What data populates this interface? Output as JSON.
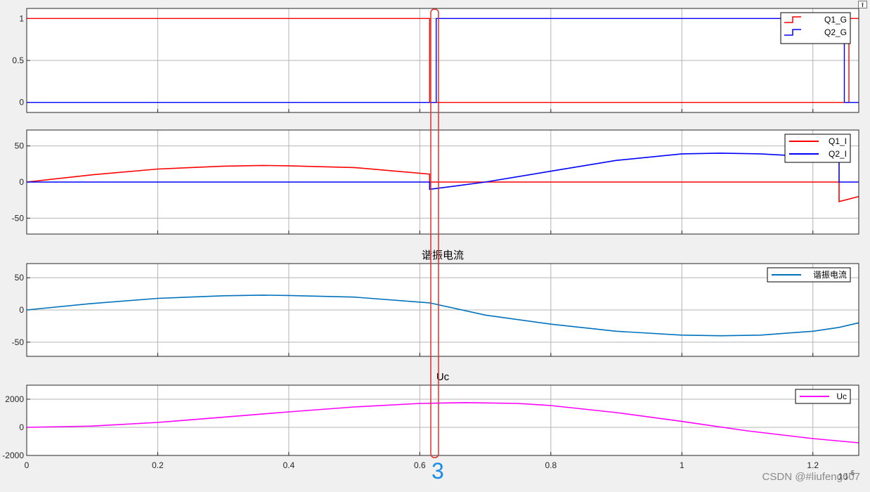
{
  "window": {
    "expand_icon": "expand-arrow-icon"
  },
  "overlay": {
    "number": "3",
    "marker_color": "#e0302a"
  },
  "watermark": "CSDN @#liufeng607",
  "colors": {
    "red": "#ff0000",
    "blue": "#0000ff",
    "teal": "#0072bd",
    "magenta": "#ff00ff",
    "grid": "#b4b4b4",
    "axis": "#262626"
  },
  "chart_data": [
    {
      "type": "line",
      "title": "",
      "xlim": [
        0,
        1.27e-05
      ],
      "ylim": [
        -0.12,
        1.12
      ],
      "yticks": [
        "1",
        "0.5",
        "0"
      ],
      "ytick_values": [
        1,
        0.5,
        0
      ],
      "legend_position": "top-right",
      "legend_style": "step",
      "series": [
        {
          "name": "Q1_G",
          "color": "#ff0000",
          "x": [
            0,
            6.15e-06,
            6.15e-06,
            1.255e-05,
            1.255e-05,
            1.27e-05
          ],
          "y": [
            1,
            1,
            0,
            0,
            1,
            1
          ]
        },
        {
          "name": "Q2_G",
          "color": "#0000ff",
          "x": [
            0,
            6.25e-06,
            6.25e-06,
            1.248e-05,
            1.248e-05,
            1.27e-05
          ],
          "y": [
            0,
            0,
            1,
            1,
            0,
            0
          ]
        }
      ]
    },
    {
      "type": "line",
      "title": "",
      "xlim": [
        0,
        1.27e-05
      ],
      "ylim": [
        -72,
        72
      ],
      "yticks": [
        "50",
        "0",
        "-50"
      ],
      "ytick_values": [
        50,
        0,
        -50
      ],
      "legend_position": "top-right",
      "legend_style": "line",
      "series": [
        {
          "name": "Q1_I",
          "color": "#ff0000",
          "x": [
            0,
            1e-06,
            2e-06,
            3e-06,
            3.6e-06,
            4e-06,
            5e-06,
            6.15e-06,
            6.15e-06,
            1.24e-05,
            1.24e-05,
            1.27e-05
          ],
          "y": [
            0,
            10,
            18,
            22,
            23,
            22.5,
            20,
            11,
            0,
            0,
            -27,
            -20
          ]
        },
        {
          "name": "Q2_I",
          "color": "#0000ff",
          "x": [
            0,
            6.15e-06,
            6.15e-06,
            6.5e-06,
            7e-06,
            8e-06,
            9e-06,
            1e-05,
            1.06e-05,
            1.12e-05,
            1.2e-05,
            1.24e-05,
            1.24e-05,
            1.27e-05
          ],
          "y": [
            0,
            0,
            -10,
            -6,
            0,
            15,
            30,
            39,
            40,
            39,
            35,
            30,
            0,
            0
          ]
        }
      ]
    },
    {
      "type": "line",
      "title": "谐振电流",
      "xlim": [
        0,
        1.27e-05
      ],
      "ylim": [
        -72,
        72
      ],
      "yticks": [
        "50",
        "0",
        "-50"
      ],
      "ytick_values": [
        50,
        0,
        -50
      ],
      "legend_position": "top-right",
      "legend_style": "line",
      "series": [
        {
          "name": "谐振电流",
          "color": "#0072bd",
          "x": [
            0,
            1e-06,
            2e-06,
            3e-06,
            3.6e-06,
            4e-06,
            5e-06,
            6.15e-06,
            7e-06,
            8e-06,
            9e-06,
            1e-05,
            1.06e-05,
            1.12e-05,
            1.2e-05,
            1.24e-05,
            1.27e-05
          ],
          "y": [
            0,
            10,
            18,
            22,
            23,
            22.5,
            20,
            11,
            -8,
            -22,
            -33,
            -39,
            -40,
            -39,
            -33,
            -27,
            -20
          ]
        }
      ]
    },
    {
      "type": "line",
      "title": "Uc",
      "xlim": [
        0,
        1.27e-05
      ],
      "ylim": [
        -2000,
        3000
      ],
      "yticks": [
        "2000",
        "0",
        "-2000"
      ],
      "ytick_values": [
        2000,
        0,
        -2000
      ],
      "xticks": [
        "0",
        "0.2",
        "0.4",
        "0.6",
        "0.8",
        "1",
        "1.2"
      ],
      "xtick_values": [
        0,
        2e-06,
        4e-06,
        6e-06,
        8e-06,
        1e-05,
        1.2e-05
      ],
      "x_exponent": "10",
      "x_exponent_power": "-5",
      "legend_position": "top-right",
      "legend_style": "line",
      "series": [
        {
          "name": "Uc",
          "color": "#ff00ff",
          "x": [
            0,
            1e-06,
            2e-06,
            3e-06,
            4e-06,
            5e-06,
            6e-06,
            6.7e-06,
            7.5e-06,
            8e-06,
            9e-06,
            1e-05,
            1.1e-05,
            1.2e-05,
            1.27e-05
          ],
          "y": [
            0,
            90,
            350,
            720,
            1100,
            1450,
            1700,
            1760,
            1700,
            1550,
            1050,
            420,
            -250,
            -800,
            -1100
          ]
        }
      ]
    }
  ]
}
